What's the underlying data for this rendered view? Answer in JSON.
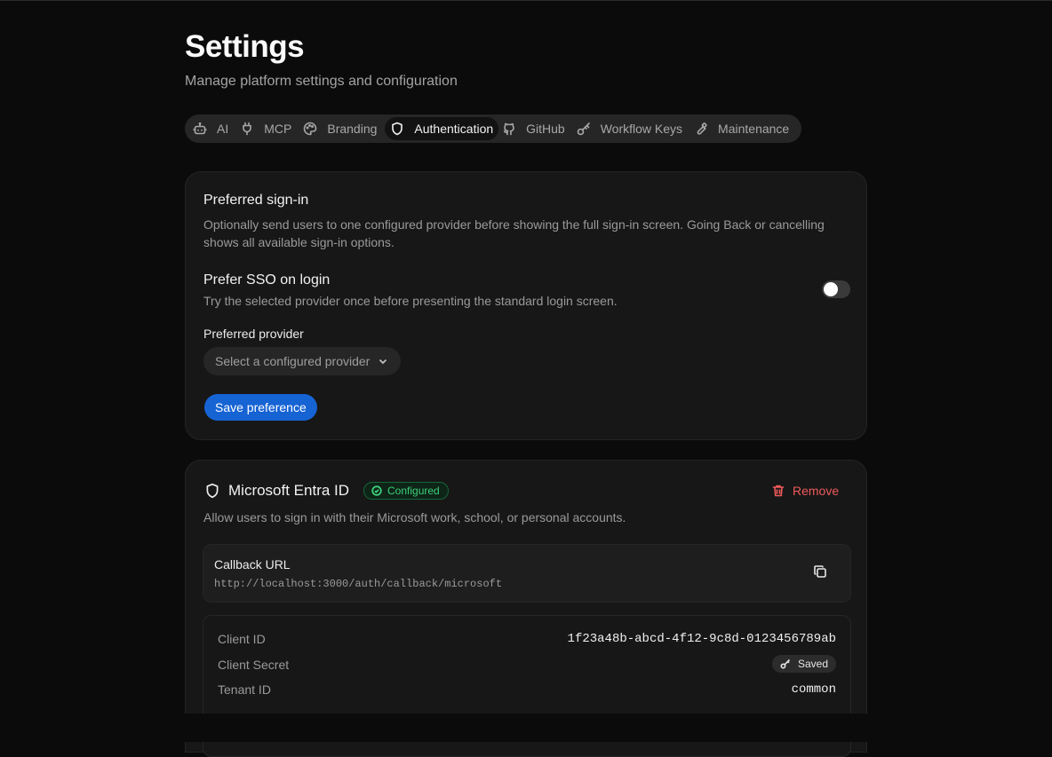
{
  "header": {
    "title": "Settings",
    "subtitle": "Manage platform settings and configuration"
  },
  "tabs": [
    {
      "label": "AI",
      "icon": "robot-icon"
    },
    {
      "label": "MCP",
      "icon": "plug-icon"
    },
    {
      "label": "Branding",
      "icon": "palette-icon"
    },
    {
      "label": "Authentication",
      "icon": "shield-icon",
      "active": true
    },
    {
      "label": "GitHub",
      "icon": "github-icon"
    },
    {
      "label": "Workflow Keys",
      "icon": "key-icon"
    },
    {
      "label": "Maintenance",
      "icon": "wrench-icon"
    }
  ],
  "preferred_signin": {
    "title": "Preferred sign-in",
    "description": "Optionally send users to one configured provider before showing the full sign-in screen. Going Back or cancelling shows all available sign-in options.",
    "sso_title": "Prefer SSO on login",
    "sso_description": "Try the selected provider once before presenting the standard login screen.",
    "sso_enabled": false,
    "provider_label": "Preferred provider",
    "provider_placeholder": "Select a configured provider",
    "save_label": "Save preference"
  },
  "provider": {
    "name": "Microsoft Entra ID",
    "status": "Configured",
    "remove_label": "Remove",
    "description": "Allow users to sign in with their Microsoft work, school, or personal accounts.",
    "callback_label": "Callback URL",
    "callback_url": "http://localhost:3000/auth/callback/microsoft",
    "fields": {
      "client_id_label": "Client ID",
      "client_id_value": "1f23a48b-abcd-4f12-9c8d-0123456789ab",
      "client_secret_label": "Client Secret",
      "client_secret_value": "Saved",
      "tenant_id_label": "Tenant ID",
      "tenant_id_value": "common"
    }
  },
  "colors": {
    "background": "#0b0b0b",
    "card": "#171717",
    "primary": "#1663d4",
    "success": "#3ecf7a",
    "danger": "#ef5a5a"
  }
}
